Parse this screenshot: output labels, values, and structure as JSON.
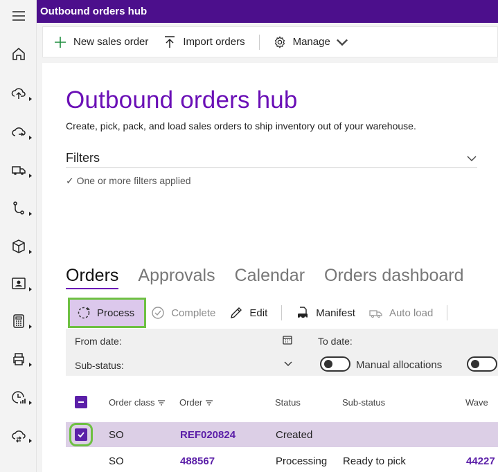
{
  "app": {
    "title": "Outbound orders hub"
  },
  "nav": {
    "items": [
      {
        "icon": "home-icon",
        "has_submenu": false
      },
      {
        "icon": "inbound-upload-icon",
        "has_submenu": true
      },
      {
        "icon": "outbound-cloud-icon",
        "has_submenu": true
      },
      {
        "icon": "truck-icon",
        "has_submenu": true
      },
      {
        "icon": "workflow-icon",
        "has_submenu": true
      },
      {
        "icon": "box-icon",
        "has_submenu": true
      },
      {
        "icon": "contact-card-icon",
        "has_submenu": true
      },
      {
        "icon": "calculator-icon",
        "has_submenu": true
      },
      {
        "icon": "printer-icon",
        "has_submenu": true
      },
      {
        "icon": "analytics-clock-icon",
        "has_submenu": true
      },
      {
        "icon": "cloud-sync-icon",
        "has_submenu": true
      }
    ]
  },
  "commandbar": {
    "new_label": "New sales order",
    "import_label": "Import orders",
    "manage_label": "Manage"
  },
  "page": {
    "title": "Outbound orders hub",
    "subtitle": "Create, pick, pack, and load sales orders to ship inventory out of your warehouse.",
    "filters_label": "Filters",
    "filters_note": "✓ One or more filters applied"
  },
  "tabs": [
    {
      "label": "Orders",
      "active": true
    },
    {
      "label": "Approvals",
      "active": false
    },
    {
      "label": "Calendar",
      "active": false
    },
    {
      "label": "Orders dashboard",
      "active": false
    }
  ],
  "toolbar": {
    "process": "Process",
    "complete": "Complete",
    "edit": "Edit",
    "manifest": "Manifest",
    "autoload": "Auto load"
  },
  "filterpanel": {
    "from_date": "From date:",
    "to_date": "To date:",
    "sub_status": "Sub-status:",
    "manual_allocations": "Manual allocations"
  },
  "table": {
    "headers": {
      "order_class": "Order class",
      "order": "Order",
      "status": "Status",
      "sub_status": "Sub-status",
      "wave": "Wave"
    },
    "rows": [
      {
        "order_class": "SO",
        "order": "REF020824",
        "status": "Created",
        "sub_status": "",
        "wave": "",
        "selected": true
      },
      {
        "order_class": "SO",
        "order": "488567",
        "status": "Processing",
        "sub_status": "Ready to pick",
        "wave": "44227",
        "selected": false
      }
    ]
  },
  "colors": {
    "brand": "#4c0f8c",
    "accent": "#6a0fb6",
    "highlight": "#6ec043",
    "selected_row": "#dccfe6"
  }
}
